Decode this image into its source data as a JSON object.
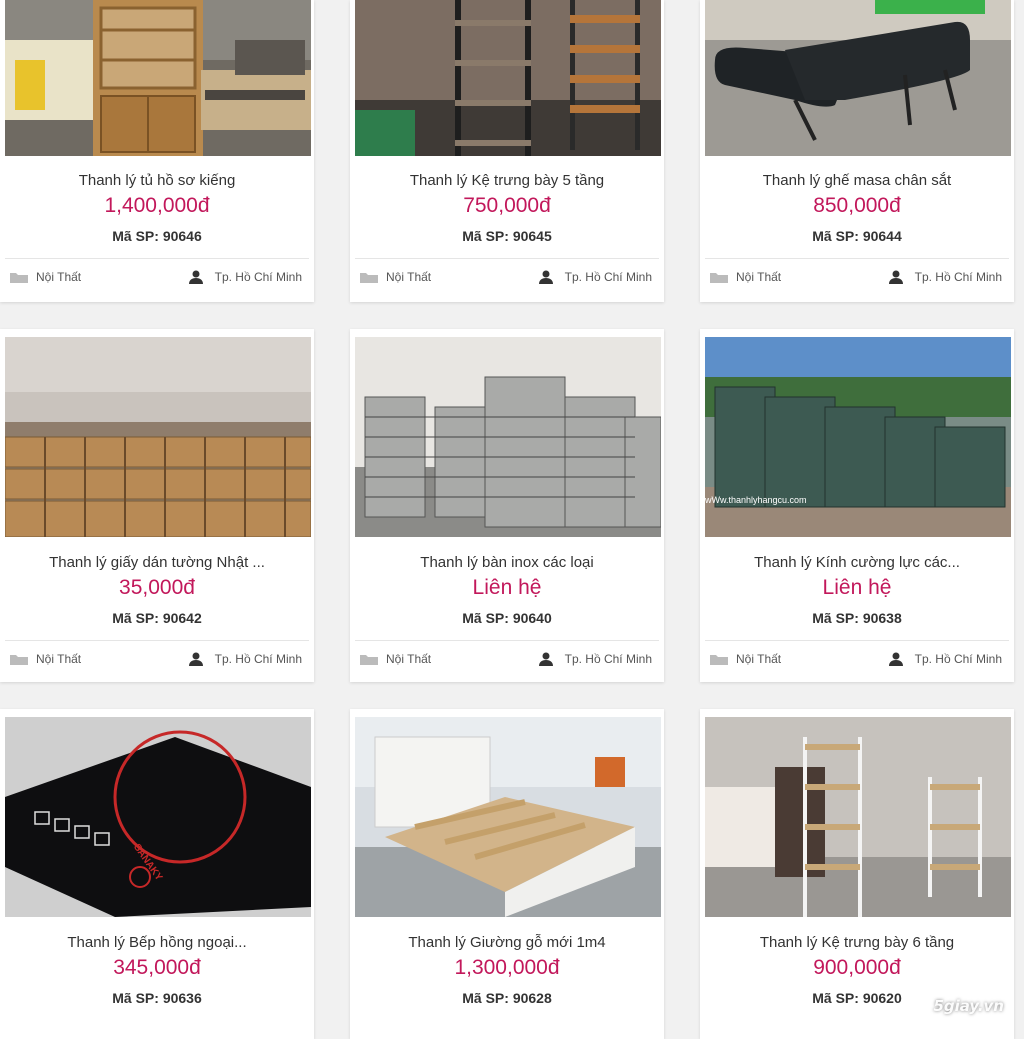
{
  "listings": [
    {
      "title": "Thanh lý tủ hồ sơ kiếng",
      "price": "1,400,000đ",
      "code": "Mã SP: 90646",
      "category": "Nội Thất",
      "location": "Tp. Hồ Chí Minh",
      "image": "cabinet-image"
    },
    {
      "title": "Thanh lý Kệ trưng bày 5 tầng",
      "price": "750,000đ",
      "code": "Mã SP: 90645",
      "category": "Nội Thất",
      "location": "Tp. Hồ Chí Minh",
      "image": "shelf-image"
    },
    {
      "title": "Thanh lý ghế masa chân sắt",
      "price": "850,000đ",
      "code": "Mã SP: 90644",
      "category": "Nội Thất",
      "location": "Tp. Hồ Chí Minh",
      "image": "massage-bed-image"
    },
    {
      "title": "Thanh lý giấy dán tường Nhật ...",
      "price": "35,000đ",
      "code": "Mã SP: 90642",
      "category": "Nội Thất",
      "location": "Tp. Hồ Chí Minh",
      "image": "wallpaper-rolls-image"
    },
    {
      "title": "Thanh lý bàn inox các loại",
      "price": "Liên hệ",
      "code": "Mã SP: 90640",
      "category": "Nội Thất",
      "location": "Tp. Hồ Chí Minh",
      "image": "inox-tables-image"
    },
    {
      "title": "Thanh lý Kính cường lực các...",
      "price": "Liên hệ",
      "code": "Mã SP: 90638",
      "category": "Nội Thất",
      "location": "Tp. Hồ Chí Minh",
      "image": "tempered-glass-image",
      "image_caption": "wWw.thanhlyhangcu.com"
    },
    {
      "title": "Thanh lý Bếp hồng ngoại...",
      "price": "345,000đ",
      "code": "Mã SP: 90636",
      "image": "infrared-cooker-image",
      "image_brand": "SANAKY"
    },
    {
      "title": "Thanh lý Giường gỗ mới 1m4",
      "price": "1,300,000đ",
      "code": "Mã SP: 90628",
      "image": "wooden-bed-image"
    },
    {
      "title": "Thanh lý Kệ trưng bày 6 tầng",
      "price": "900,000đ",
      "code": "Mã SP: 90620",
      "image": "six-tier-shelf-image"
    }
  ],
  "watermark": "5giay.vn",
  "colors": {
    "price": "#c2185b",
    "background": "#f1f1f1",
    "card": "#ffffff"
  }
}
